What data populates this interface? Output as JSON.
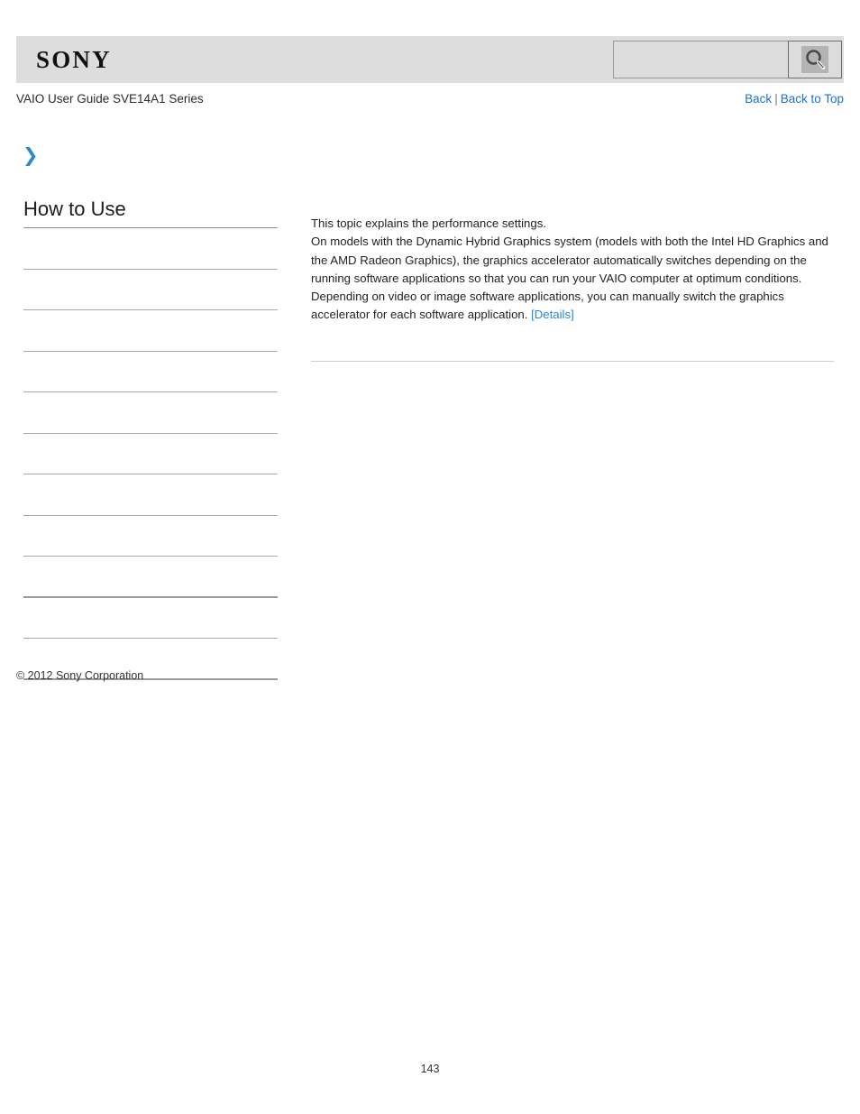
{
  "header": {
    "logo_text": "SONY",
    "search": {
      "value": "",
      "placeholder": "",
      "icon": "search-icon",
      "button_label": ""
    }
  },
  "subheader": {
    "guide_title": "VAIO User Guide SVE14A1 Series",
    "nav": {
      "back_label": "Back",
      "separator": "|",
      "back_to_top_label": "Back to Top"
    }
  },
  "sidebar": {
    "expand_icon": "❯",
    "heading": "How to Use",
    "items": [
      {
        "label": "",
        "thick": false
      },
      {
        "label": "",
        "thick": false
      },
      {
        "label": "",
        "thick": false
      },
      {
        "label": "",
        "thick": false
      },
      {
        "label": "",
        "thick": false
      },
      {
        "label": "",
        "thick": false
      },
      {
        "label": "",
        "thick": false
      },
      {
        "label": "",
        "thick": false
      },
      {
        "label": "",
        "thick": true
      },
      {
        "label": "",
        "thick": false
      },
      {
        "label": "",
        "thick": true
      }
    ],
    "copyright": "© 2012 Sony Corporation"
  },
  "content": {
    "paragraph_1": "This topic explains the performance settings.",
    "paragraph_2": "On models with the Dynamic Hybrid Graphics system (models with both the Intel HD Graphics and the AMD Radeon Graphics), the graphics accelerator automatically switches depending on the running software applications so that you can run your VAIO computer at optimum conditions.",
    "paragraph_3_text": "Depending on video or image software applications, you can manually switch the graphics accelerator for each software application. ",
    "details_link": "[Details]"
  },
  "footer": {
    "page_number": "143"
  },
  "colors": {
    "header_band": "#dddddd",
    "link_blue": "#1a6fd4",
    "content_link_blue": "#2a86d8",
    "chevron_blue": "#2e8bc8",
    "rule_gray": "#a8a8a8"
  }
}
